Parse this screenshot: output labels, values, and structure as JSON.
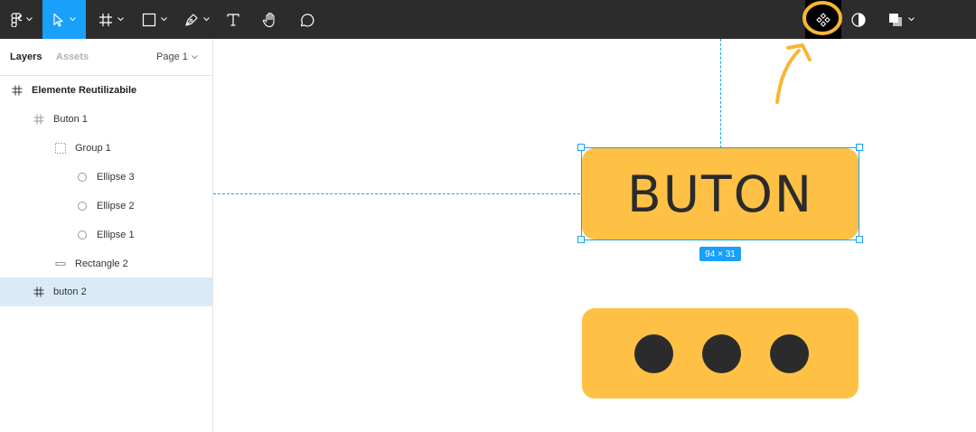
{
  "toolbar": {
    "tools": [
      {
        "name": "figma-menu-icon",
        "active": false
      },
      {
        "name": "move-tool-icon",
        "active": true
      },
      {
        "name": "frame-tool-icon",
        "active": false
      },
      {
        "name": "shape-tool-icon",
        "active": false
      },
      {
        "name": "pen-tool-icon",
        "active": false
      },
      {
        "name": "text-tool-icon",
        "active": false
      },
      {
        "name": "hand-tool-icon",
        "active": false
      },
      {
        "name": "comment-tool-icon",
        "active": false
      }
    ],
    "right_tools": [
      "create-component-icon",
      "mask-icon",
      "boolean-ops-icon"
    ],
    "active_color": "#18a0fb",
    "highlight_color": "#f7b733"
  },
  "panel": {
    "tabs": {
      "layers": "Layers",
      "assets": "Assets"
    },
    "page": "Page 1",
    "layers": [
      {
        "label": "Elemente Reutilizabile",
        "icon": "frame-icon",
        "indent": 0,
        "bold": true,
        "selected": false
      },
      {
        "label": "Buton 1",
        "icon": "frame-icon",
        "indent": 1,
        "bold": false,
        "selected": false
      },
      {
        "label": "Group 1",
        "icon": "group-icon",
        "indent": 2,
        "bold": false,
        "selected": false
      },
      {
        "label": "Ellipse 3",
        "icon": "ellipse-icon",
        "indent": 3,
        "bold": false,
        "selected": false
      },
      {
        "label": "Ellipse 2",
        "icon": "ellipse-icon",
        "indent": 3,
        "bold": false,
        "selected": false
      },
      {
        "label": "Ellipse 1",
        "icon": "ellipse-icon",
        "indent": 3,
        "bold": false,
        "selected": false
      },
      {
        "label": "Rectangle 2",
        "icon": "rectangle-icon",
        "indent": 2,
        "bold": false,
        "selected": false
      },
      {
        "label": "buton 2",
        "icon": "frame-icon",
        "indent": 1,
        "bold": false,
        "selected": true
      }
    ]
  },
  "canvas": {
    "button1_text": "BUTON",
    "dimension_label": "94 × 31",
    "button_color": "#ffc145",
    "text_color": "#2b2b2b"
  }
}
